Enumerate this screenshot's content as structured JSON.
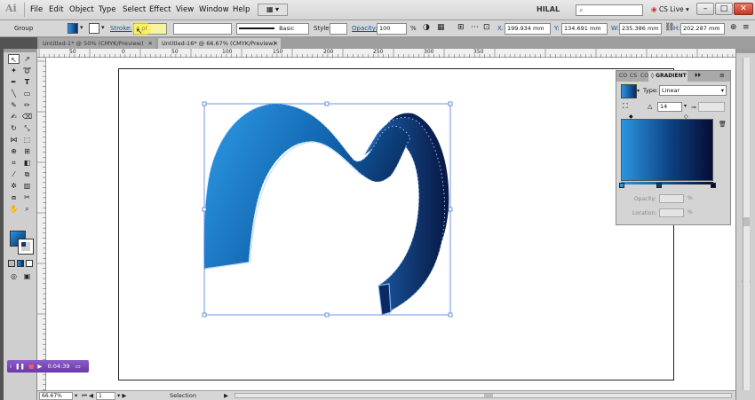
{
  "app": {
    "logo": "Ai",
    "brand_color": "#a9a9a9",
    "user": "HILAL",
    "cs_live": "CS Live"
  },
  "menu": {
    "items": [
      "File",
      "Edit",
      "Object",
      "Type",
      "Select",
      "Effect",
      "View",
      "Window",
      "Help"
    ]
  },
  "control_bar": {
    "selection_label": "Group",
    "stroke_label": "Stroke:",
    "stroke_value": "4 pt",
    "profile_label": "Basic",
    "style_label": "Style:",
    "opacity_label": "Opacity:",
    "opacity_value": "100",
    "x_label": "X:",
    "x_value": "199.934 mm",
    "y_label": "Y:",
    "y_value": "134.691 mm",
    "w_label": "W:",
    "w_value": "235.386 mm",
    "h_label": "H:",
    "h_value": "202.287 mm"
  },
  "tabs": [
    {
      "label": "Untitled-1* @ 50% (CMYK/Preview)",
      "active": false
    },
    {
      "label": "Untitled-16* @ 66.67% (CMYK/Preview)",
      "active": true
    }
  ],
  "ruler": {
    "h_labels": [
      "50",
      "0",
      "50",
      "100",
      "150",
      "200",
      "250",
      "300",
      "350"
    ]
  },
  "gradient_panel": {
    "tabs": [
      "CO",
      "CS",
      "CO",
      "GRADIENT"
    ],
    "type_label": "Type:",
    "type_value": "Linear",
    "angle_value": "14",
    "opacity_label": "Opacity:",
    "location_label": "Location:",
    "percent": "%",
    "colors": {
      "start": "#2a95e0",
      "end": "#050d33"
    }
  },
  "artwork": {
    "name": "3D M letter",
    "colors": {
      "light": "#2a92de",
      "mid": "#0f5fa8",
      "dark": "#0a1a44"
    }
  },
  "recorder": {
    "time": "0:04:39"
  },
  "status_bar": {
    "zoom": "66.67%",
    "page": "1",
    "mode": "Selection"
  }
}
